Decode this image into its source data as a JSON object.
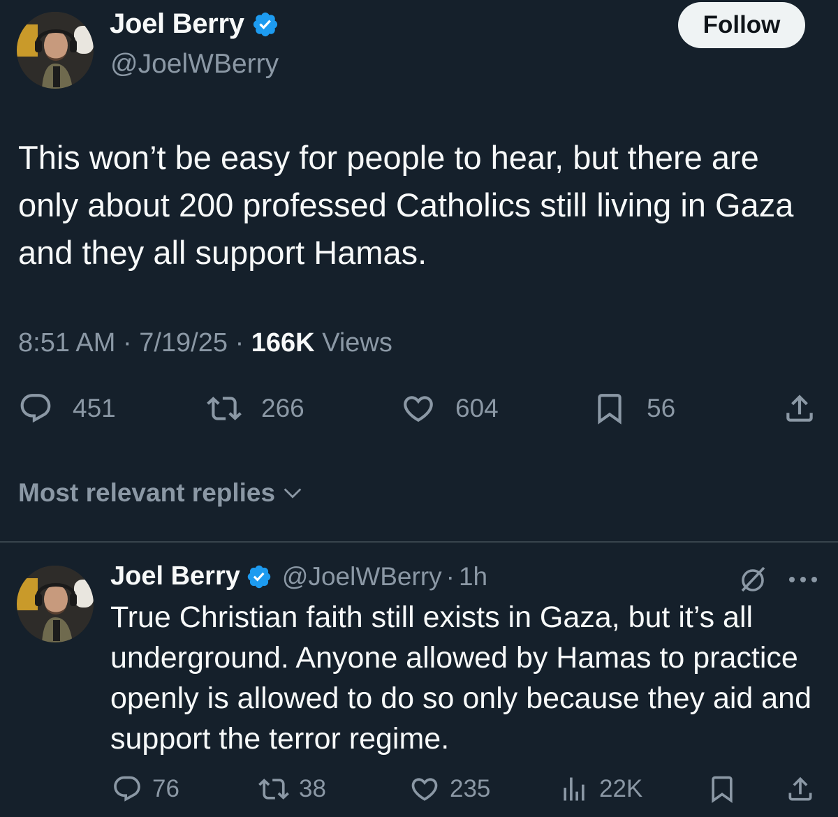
{
  "tweet": {
    "author_name": "Joel Berry",
    "handle": "@JoelWBerry",
    "follow_label": "Follow",
    "text": "This won’t be easy for people to hear, but there are only about 200 professed Catholics still living in Gaza and they all support Hamas.",
    "time": "8:51 AM",
    "date": "7/19/25",
    "separator": "·",
    "views_count": "166K",
    "views_label": "Views",
    "stats": {
      "replies": "451",
      "reposts": "266",
      "likes": "604",
      "bookmarks": "56"
    }
  },
  "replies_sort": {
    "label": "Most relevant replies"
  },
  "reply": {
    "author_name": "Joel Berry",
    "handle": "@JoelWBerry",
    "separator": "·",
    "age": "1h",
    "text": "True Christian faith still exists in Gaza, but it’s all underground. Anyone allowed by Hamas to practice openly is allowed to do so only because they aid and support the terror regime.",
    "stats": {
      "replies": "76",
      "reposts": "38",
      "likes": "235",
      "views": "22K"
    }
  },
  "colors": {
    "background": "#15202b",
    "text_primary": "#f7f9f9",
    "text_secondary": "#8b98a5",
    "verified_blue": "#1d9bf0",
    "divider": "#38444d",
    "follow_button_bg": "#eff3f4"
  },
  "icons": {
    "verified": "verified-badge-icon",
    "reply": "speech-bubble-icon",
    "repost": "repost-arrows-icon",
    "like": "heart-icon",
    "bookmark": "bookmark-icon",
    "share": "share-upload-icon",
    "views": "bar-chart-icon",
    "grok": "grok-slash-circle-icon",
    "more": "ellipsis-icon",
    "sort": "chevron-down-icon"
  }
}
